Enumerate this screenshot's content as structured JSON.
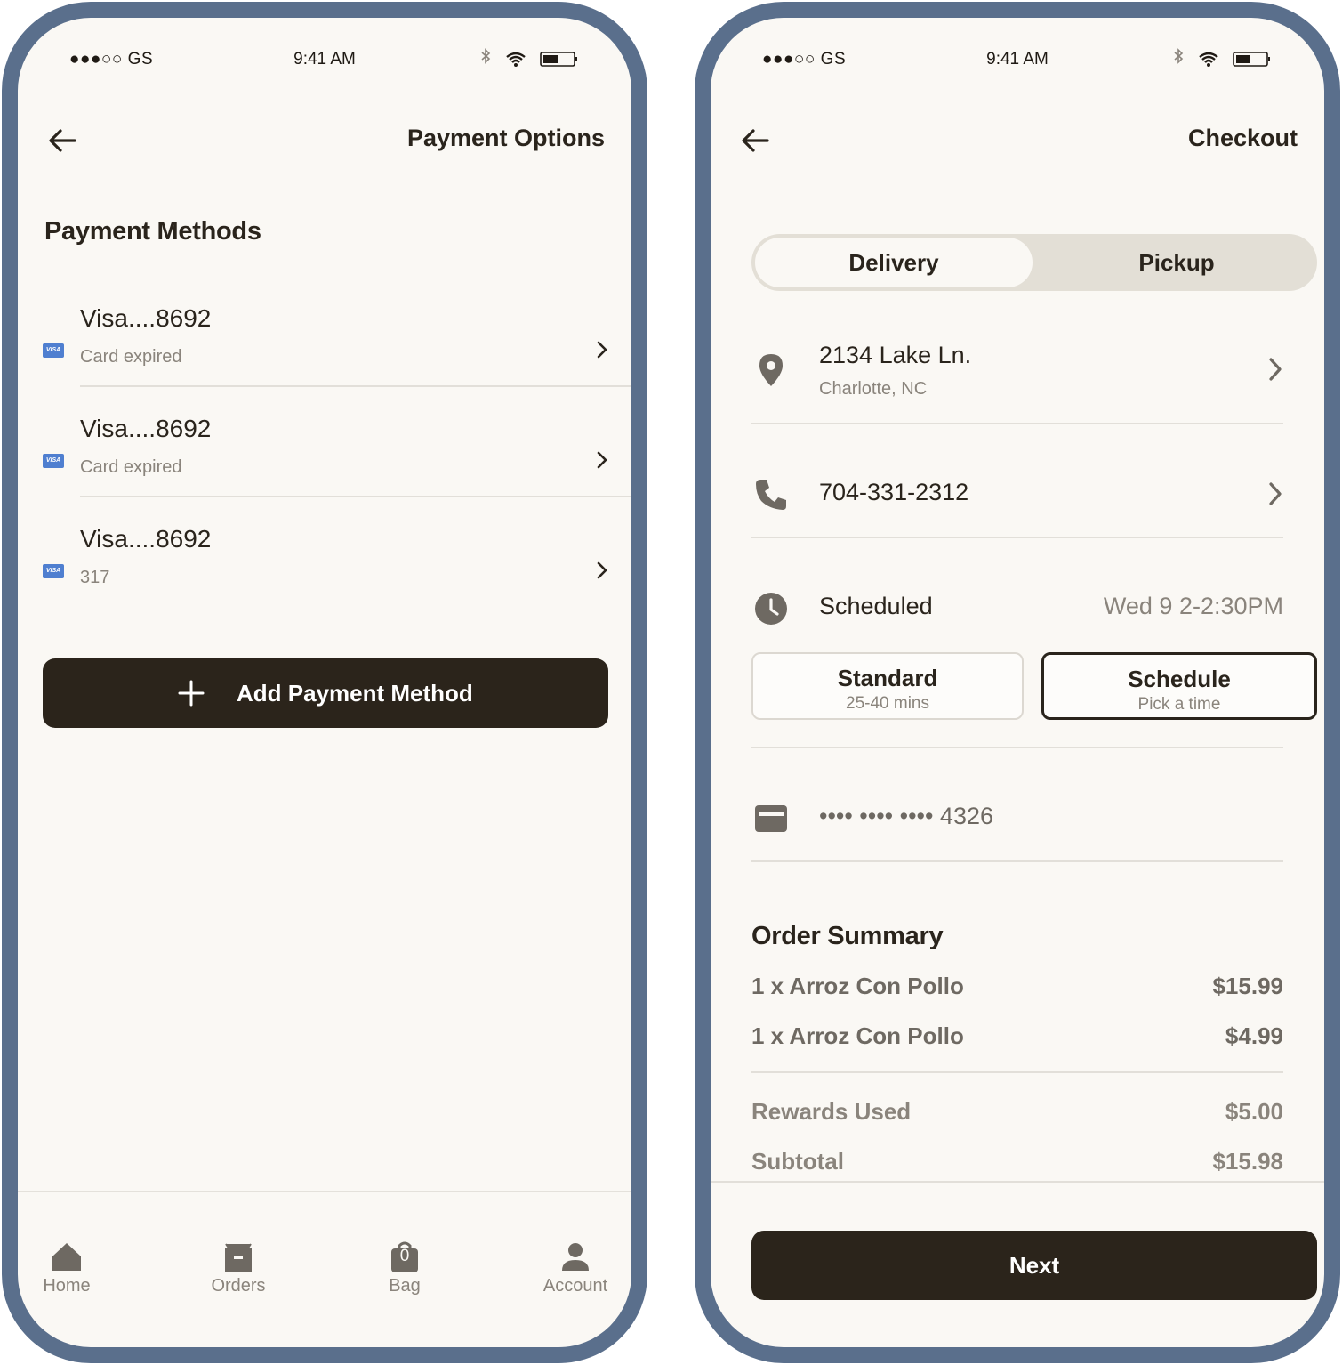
{
  "left": {
    "status": {
      "carrier": "●●●○○ GS",
      "time": "9:41 AM"
    },
    "header": {
      "title": "Payment Options"
    },
    "section_title": "Payment Methods",
    "payment_methods": [
      {
        "brand": "VISA",
        "name": "Visa....8692",
        "subtitle": "Card expired"
      },
      {
        "brand": "VISA",
        "name": "Visa....8692",
        "subtitle": "Card expired"
      },
      {
        "brand": "VISA",
        "name": "Visa....8692",
        "subtitle": "317"
      }
    ],
    "add_button": {
      "label": "Add Payment Method"
    },
    "tabs": [
      {
        "label": "Home",
        "icon": "home-icon"
      },
      {
        "label": "Orders",
        "icon": "orders-icon"
      },
      {
        "label": "Bag",
        "icon": "bag-icon",
        "badge": "0"
      },
      {
        "label": "Account",
        "icon": "account-icon"
      }
    ]
  },
  "right": {
    "status": {
      "carrier": "●●●○○ GS",
      "time": "9:41 AM"
    },
    "header": {
      "title": "Checkout"
    },
    "segment": {
      "delivery": "Delivery",
      "pickup": "Pickup",
      "selected": "Delivery"
    },
    "address": {
      "line1": "2134 Lake Ln.",
      "line2": "Charlotte, NC"
    },
    "phone": "704-331-2312",
    "schedule": {
      "label": "Scheduled",
      "value": "Wed 9 2-2:30PM"
    },
    "options": {
      "standard": {
        "title": "Standard",
        "subtitle": "25-40 mins"
      },
      "schedule": {
        "title": "Schedule",
        "subtitle": "Pick a time",
        "selected": true
      }
    },
    "card": "•••• •••• •••• 4326",
    "order_summary": {
      "title": "Order Summary",
      "items": [
        {
          "name": "1 x Arroz Con Pollo",
          "price": "$15.99"
        },
        {
          "name": "1 x Arroz Con Pollo",
          "price": "$4.99"
        }
      ],
      "rewards": {
        "label": "Rewards Used",
        "value": "$5.00"
      },
      "subtotal": {
        "label": "Subtotal",
        "value": "$15.98"
      }
    },
    "next_button": {
      "label": "Next"
    }
  },
  "colors": {
    "frame": "#5a6f8c",
    "background": "#faf8f4",
    "primary": "#2b241b",
    "visa": "#4f7fd0",
    "segment": "#e3dfd6"
  }
}
